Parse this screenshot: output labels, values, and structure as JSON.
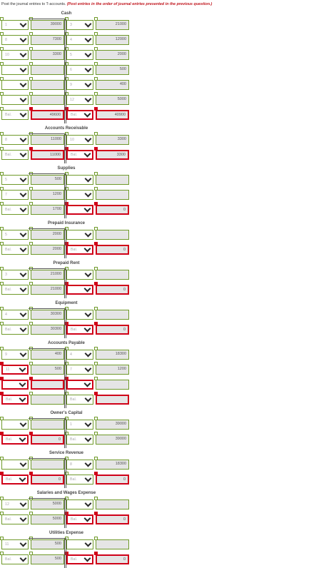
{
  "instruction": {
    "main": "Post the journal entries to T-accounts.",
    "emphasis": "(Post entries in the order of journal entries presented in the previous question.)"
  },
  "accounts": [
    {
      "title": "Cash",
      "rows": [
        {
          "ld": {
            "t": "1",
            "s": "g"
          },
          "la": {
            "t": "39000",
            "s": "g"
          },
          "rd": {
            "t": "3",
            "s": "g"
          },
          "ra": {
            "t": "21000",
            "s": "g"
          }
        },
        {
          "ld": {
            "t": "8",
            "s": "g"
          },
          "la": {
            "t": "7300",
            "s": "g"
          },
          "rd": {
            "t": "4",
            "s": "g"
          },
          "ra": {
            "t": "12000",
            "s": "g"
          }
        },
        {
          "ld": {
            "t": "10",
            "s": "g"
          },
          "la": {
            "t": "3300",
            "s": "g"
          },
          "rd": {
            "t": "5",
            "s": "g"
          },
          "ra": {
            "t": "2000",
            "s": "g"
          }
        },
        {
          "ld": {
            "t": "",
            "s": "g"
          },
          "la": {
            "t": "",
            "s": "g"
          },
          "rd": {
            "t": "6",
            "s": "g"
          },
          "ra": {
            "t": "500",
            "s": "g"
          }
        },
        {
          "ld": {
            "t": "",
            "s": "g"
          },
          "la": {
            "t": "",
            "s": "g"
          },
          "rd": {
            "t": "9",
            "s": "g"
          },
          "ra": {
            "t": "400",
            "s": "g"
          }
        },
        {
          "ld": {
            "t": "",
            "s": "g"
          },
          "la": {
            "t": "",
            "s": "g"
          },
          "rd": {
            "t": "12",
            "s": "g"
          },
          "ra": {
            "t": "5000",
            "s": "g"
          }
        }
      ],
      "bal": {
        "ld": {
          "t": "Bal.",
          "s": "g"
        },
        "la": {
          "t": "49600",
          "s": "r"
        },
        "rd": {
          "t": "Bal.",
          "s": "r"
        },
        "ra": {
          "t": "40900",
          "s": "r"
        }
      }
    },
    {
      "title": "Accounts Receivable",
      "rows": [
        {
          "ld": {
            "t": "8",
            "s": "g"
          },
          "la": {
            "t": "11000",
            "s": "g"
          },
          "rd": {
            "t": "10",
            "s": "g"
          },
          "ra": {
            "t": "3300",
            "s": "g"
          }
        }
      ],
      "bal": {
        "ld": {
          "t": "Bal.",
          "s": "g"
        },
        "la": {
          "t": "11000",
          "s": "r"
        },
        "rd": {
          "t": "Bal.",
          "s": "r"
        },
        "ra": {
          "t": "3300",
          "s": "r"
        }
      }
    },
    {
      "title": "Supplies",
      "rows": [
        {
          "ld": {
            "t": "5",
            "s": "g"
          },
          "la": {
            "t": "500",
            "s": "g"
          },
          "rd": {
            "t": "",
            "s": "g"
          },
          "ra": {
            "t": "",
            "s": "g"
          }
        },
        {
          "ld": {
            "t": "7",
            "s": "g"
          },
          "la": {
            "t": "1200",
            "s": "g"
          },
          "rd": {
            "t": "",
            "s": "g"
          },
          "ra": {
            "t": "",
            "s": "g"
          }
        }
      ],
      "bal": {
        "ld": {
          "t": "Bal.",
          "s": "g"
        },
        "la": {
          "t": "1700",
          "s": "g"
        },
        "rd": {
          "t": "",
          "s": "r"
        },
        "ra": {
          "t": "0",
          "s": "r"
        }
      }
    },
    {
      "title": "Prepaid Insurance",
      "rows": [
        {
          "ld": {
            "t": "5",
            "s": "g"
          },
          "la": {
            "t": "2000",
            "s": "g"
          },
          "rd": {
            "t": "",
            "s": "g"
          },
          "ra": {
            "t": "",
            "s": "g"
          }
        }
      ],
      "bal": {
        "ld": {
          "t": "Bal.",
          "s": "g"
        },
        "la": {
          "t": "2000",
          "s": "g"
        },
        "rd": {
          "t": "Bal.",
          "s": "r"
        },
        "ra": {
          "t": "0",
          "s": "r"
        }
      }
    },
    {
      "title": "Prepaid Rent",
      "rows": [
        {
          "ld": {
            "t": "3",
            "s": "g"
          },
          "la": {
            "t": "21000",
            "s": "g"
          },
          "rd": {
            "t": "",
            "s": "g"
          },
          "ra": {
            "t": "",
            "s": "g"
          }
        }
      ],
      "bal": {
        "ld": {
          "t": "Bal.",
          "s": "g"
        },
        "la": {
          "t": "21000",
          "s": "g"
        },
        "rd": {
          "t": "",
          "s": "r"
        },
        "ra": {
          "t": "0",
          "s": "r"
        }
      }
    },
    {
      "title": "Equipment",
      "rows": [
        {
          "ld": {
            "t": "4",
            "s": "g"
          },
          "la": {
            "t": "30300",
            "s": "g"
          },
          "rd": {
            "t": "",
            "s": "g"
          },
          "ra": {
            "t": "",
            "s": "g"
          }
        }
      ],
      "bal": {
        "ld": {
          "t": "Bal.",
          "s": "g"
        },
        "la": {
          "t": "30300",
          "s": "g"
        },
        "rd": {
          "t": "Bal.",
          "s": "r"
        },
        "ra": {
          "t": "0",
          "s": "r"
        }
      }
    },
    {
      "title": "Accounts Payable",
      "rows": [
        {
          "ld": {
            "t": "9",
            "s": "g"
          },
          "la": {
            "t": "400",
            "s": "g"
          },
          "rd": {
            "t": "4",
            "s": "g"
          },
          "ra": {
            "t": "18300",
            "s": "g"
          }
        },
        {
          "ld": {
            "t": "11",
            "s": "r"
          },
          "la": {
            "t": "500",
            "s": "g"
          },
          "rd": {
            "t": "7",
            "s": "g"
          },
          "ra": {
            "t": "1200",
            "s": "g"
          }
        },
        {
          "ld": {
            "t": "",
            "s": "r"
          },
          "la": {
            "t": "",
            "s": "r"
          },
          "rd": {
            "t": "",
            "s": "r"
          },
          "ra": {
            "t": "",
            "s": "g"
          }
        }
      ],
      "bal": {
        "ld": {
          "t": "Bal.",
          "s": "r"
        },
        "la": {
          "t": "",
          "s": "g"
        },
        "rd": {
          "t": "Bal.",
          "s": "g"
        },
        "ra": {
          "t": "",
          "s": "r"
        }
      }
    },
    {
      "title": "Owner's Capital",
      "rows": [
        {
          "ld": {
            "t": "",
            "s": "g"
          },
          "la": {
            "t": "",
            "s": "g"
          },
          "rd": {
            "t": "1",
            "s": "g"
          },
          "ra": {
            "t": "39000",
            "s": "g"
          }
        }
      ],
      "bal": {
        "ld": {
          "t": "Bal.",
          "s": "r"
        },
        "la": {
          "t": "0",
          "s": "r"
        },
        "rd": {
          "t": "Bal.",
          "s": "g"
        },
        "ra": {
          "t": "39000",
          "s": "g"
        }
      }
    },
    {
      "title": "Service Revenue",
      "rows": [
        {
          "ld": {
            "t": "",
            "s": "g"
          },
          "la": {
            "t": "",
            "s": "g"
          },
          "rd": {
            "t": "8",
            "s": "g"
          },
          "ra": {
            "t": "18300",
            "s": "g"
          }
        }
      ],
      "bal": {
        "ld": {
          "t": "Bal.",
          "s": "r"
        },
        "la": {
          "t": "0",
          "s": "r"
        },
        "rd": {
          "t": "Bal.",
          "s": "g"
        },
        "ra": {
          "t": "0",
          "s": "r"
        }
      }
    },
    {
      "title": "Salaries and Wages Expense",
      "rows": [
        {
          "ld": {
            "t": "12",
            "s": "g"
          },
          "la": {
            "t": "5000",
            "s": "g"
          },
          "rd": {
            "t": "",
            "s": "g"
          },
          "ra": {
            "t": "",
            "s": "g"
          }
        }
      ],
      "bal": {
        "ld": {
          "t": "Bal.",
          "s": "g"
        },
        "la": {
          "t": "5000",
          "s": "g"
        },
        "rd": {
          "t": "Bal.",
          "s": "r"
        },
        "ra": {
          "t": "0",
          "s": "r"
        }
      }
    },
    {
      "title": "Utilities Expense",
      "rows": [
        {
          "ld": {
            "t": "11",
            "s": "g"
          },
          "la": {
            "t": "500",
            "s": "g"
          },
          "rd": {
            "t": "",
            "s": "g"
          },
          "ra": {
            "t": "",
            "s": "g"
          }
        }
      ],
      "bal": {
        "ld": {
          "t": "Bal.",
          "s": "g"
        },
        "la": {
          "t": "500",
          "s": "g"
        },
        "rd": {
          "t": "Bal.",
          "s": "r"
        },
        "ra": {
          "t": "0",
          "s": "r"
        }
      }
    }
  ]
}
